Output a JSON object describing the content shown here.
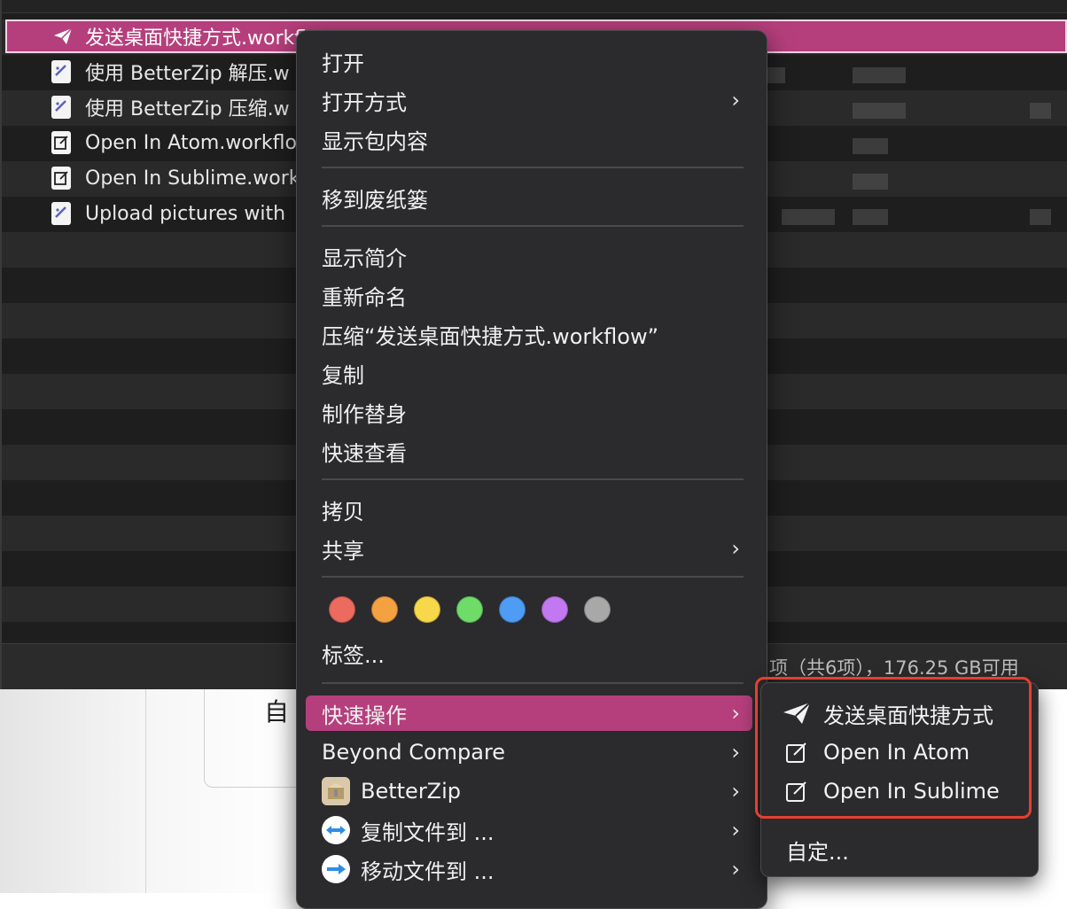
{
  "finder": {
    "files": [
      {
        "name": "发送桌面快捷方式.workfl",
        "icon": "paper-plane-icon",
        "selected": true
      },
      {
        "name": "使用 BetterZip 解压.w",
        "icon": "workflow-file-icon"
      },
      {
        "name": "使用 BetterZip 压缩.w",
        "icon": "workflow-file-icon"
      },
      {
        "name": "Open In Atom.workflo",
        "icon": "edit-icon"
      },
      {
        "name": "Open In Sublime.work",
        "icon": "edit-icon"
      },
      {
        "name": "Upload pictures with",
        "icon": "workflow-file-icon"
      }
    ],
    "status": "项（共6项），176.25 GB可用"
  },
  "lower": {
    "partial_text": "自"
  },
  "context_menu": {
    "items": {
      "open": "打开",
      "open_with": "打开方式",
      "show_package": "显示包内容",
      "move_to_trash": "移到废纸篓",
      "get_info": "显示简介",
      "rename": "重新命名",
      "compress": "压缩“发送桌面快捷方式.workflow”",
      "duplicate": "复制",
      "make_alias": "制作替身",
      "quick_look": "快速查看",
      "copy": "拷贝",
      "share": "共享",
      "tags": "标签...",
      "quick_actions": "快速操作",
      "beyond_compare": "Beyond Compare",
      "betterzip": "BetterZip",
      "copy_files_to": "复制文件到 ...",
      "move_files_to": "移动文件到 ..."
    },
    "tag_colors": [
      "#ec6a5e",
      "#f4a142",
      "#f7d84a",
      "#6fdc6a",
      "#4e9cf5",
      "#c178f0",
      "#a8a8a8"
    ]
  },
  "quick_actions_submenu": {
    "items": [
      {
        "label": "发送桌面快捷方式",
        "icon": "paper-plane-icon"
      },
      {
        "label": "Open In Atom",
        "icon": "edit-icon"
      },
      {
        "label": "Open In Sublime",
        "icon": "edit-icon"
      }
    ],
    "customize": "自定..."
  },
  "colors": {
    "highlight": "#b53f7c",
    "annotation": "#e4402f"
  }
}
